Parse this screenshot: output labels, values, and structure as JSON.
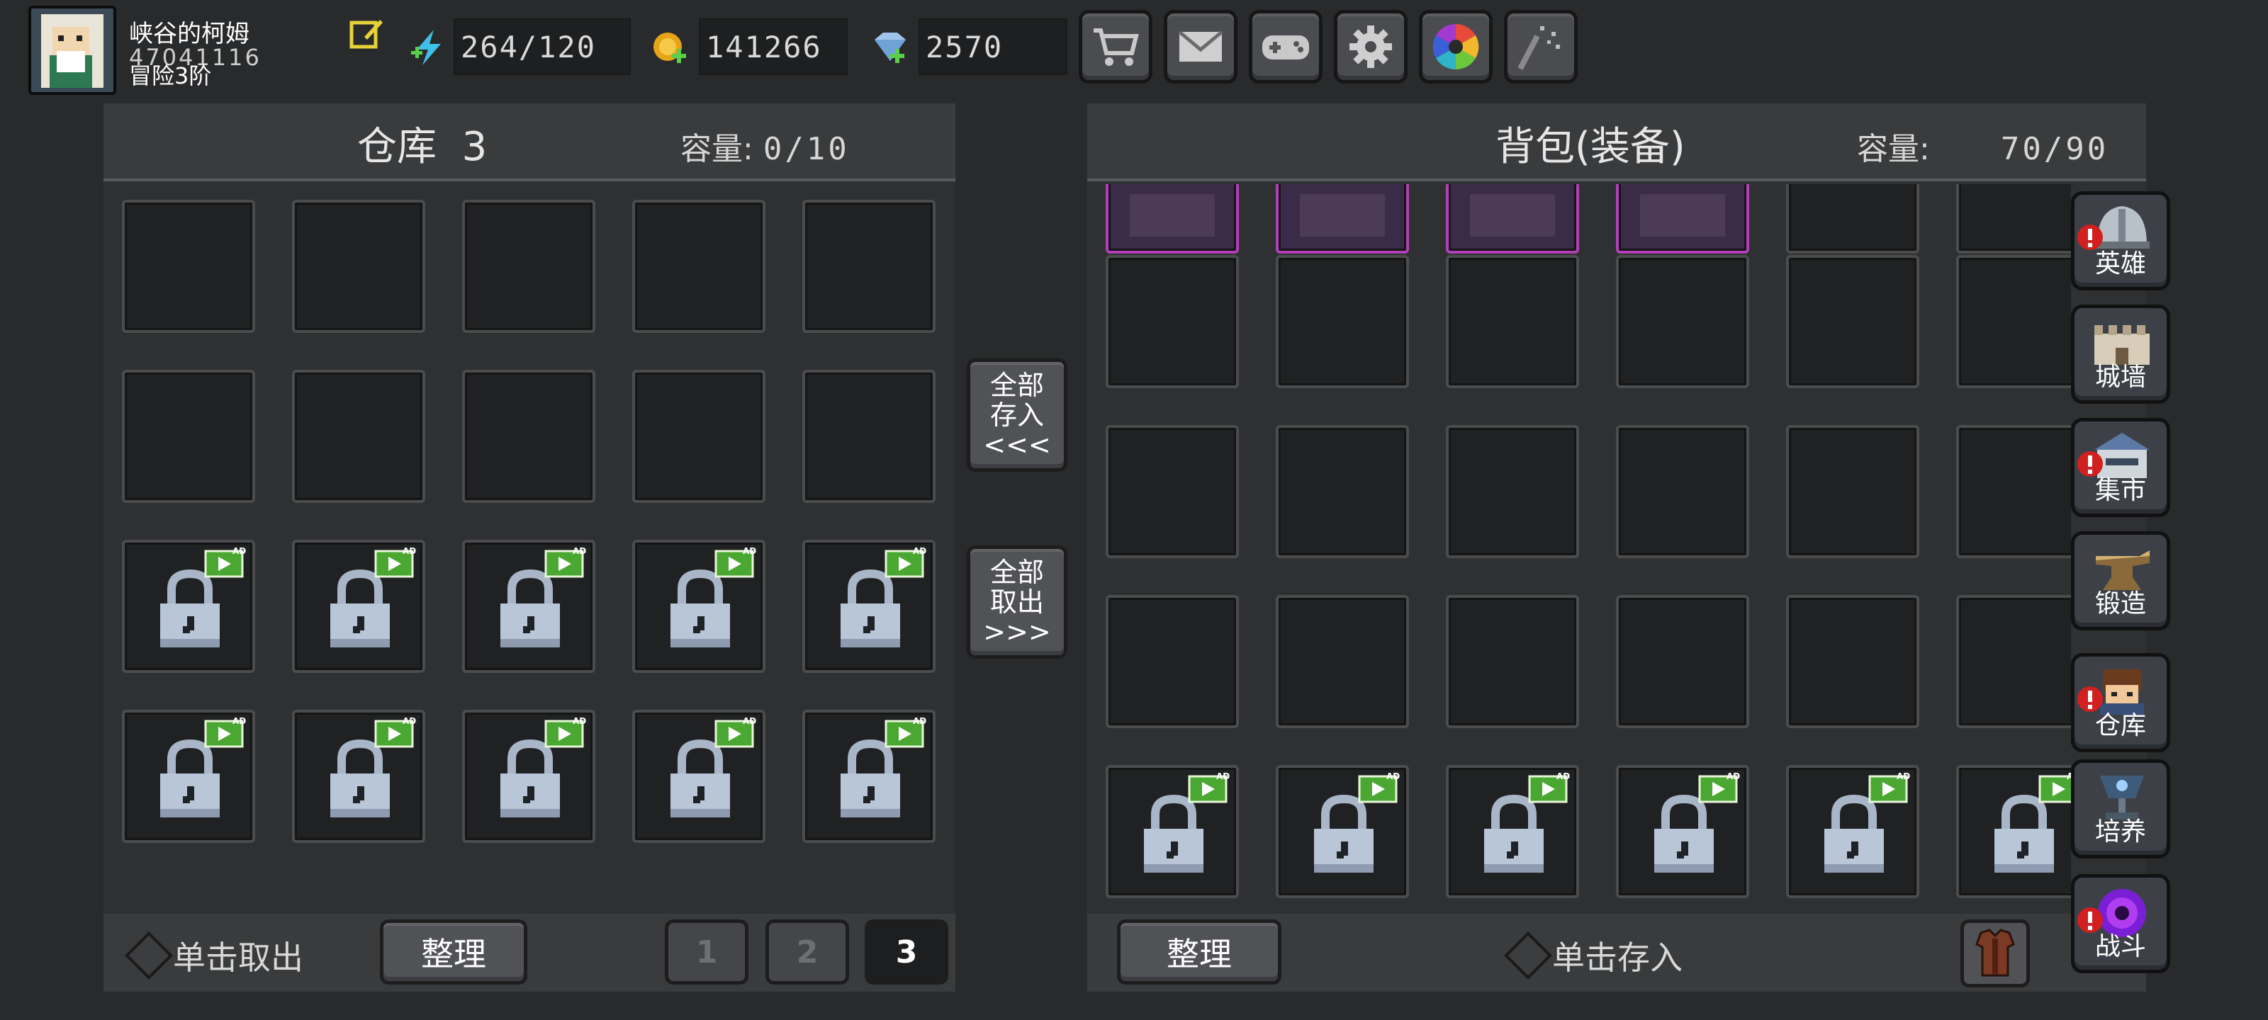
{
  "player": {
    "name": "峡谷的柯姆",
    "id": "47041116",
    "level": "冒险3阶"
  },
  "resources": {
    "energy": "264/120",
    "gold": "141266",
    "gems": "2570"
  },
  "toolbar": {
    "icons": [
      "cart-icon",
      "mail-icon",
      "gamepad-icon",
      "gear-icon",
      "color-wheel-icon",
      "sparkle-icon"
    ]
  },
  "warehouse": {
    "title": "仓库",
    "page": "3",
    "capacity_label": "容量:",
    "capacity_value": "0/10",
    "hint": "单击取出",
    "sort_label": "整理",
    "pages": [
      "1",
      "2",
      "3"
    ],
    "active_page": "3"
  },
  "transfer": {
    "deposit_all": [
      "全部",
      "存入",
      "<<<"
    ],
    "withdraw_all": [
      "全部",
      "取出",
      ">>>"
    ]
  },
  "backpack": {
    "title": "背包(装备)",
    "capacity_label": "容量:",
    "capacity_value": "70/90",
    "sort_label": "整理",
    "hint": "单击存入"
  },
  "nav": [
    {
      "label": "英雄",
      "icon": "helmet-icon",
      "alert": true
    },
    {
      "label": "城墙",
      "icon": "wall-icon",
      "alert": false
    },
    {
      "label": "集市",
      "icon": "market-icon",
      "alert": true
    },
    {
      "label": "锻造",
      "icon": "anvil-icon",
      "alert": false
    },
    {
      "label": "仓库",
      "icon": "merchant-icon",
      "alert": true
    },
    {
      "label": "培养",
      "icon": "chalice-icon",
      "alert": false
    },
    {
      "label": "战斗",
      "icon": "portal-icon",
      "alert": true
    }
  ],
  "colors": {
    "background": "#292a2b",
    "panel": "#2f3031",
    "rare_border": "#b23fb8",
    "alert": "#d21f1f",
    "ad_green": "#4aa832"
  }
}
